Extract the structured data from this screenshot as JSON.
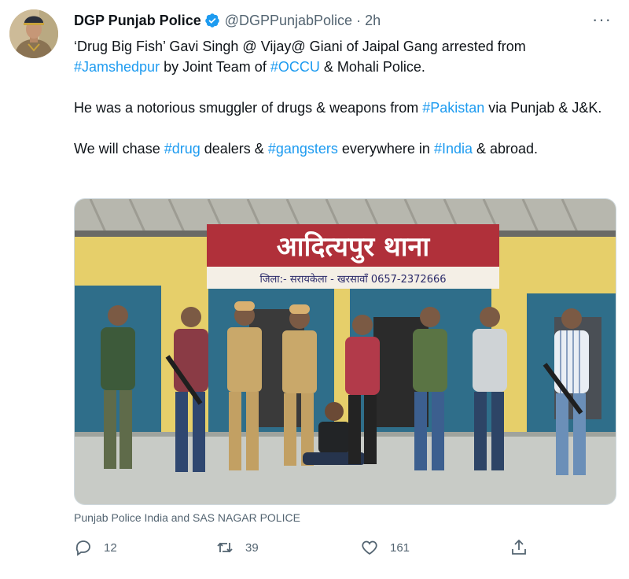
{
  "author": {
    "display_name": "DGP Punjab Police",
    "handle": "@DGPPunjabPolice",
    "separator": "·",
    "time": "2h"
  },
  "more_label": "···",
  "text": {
    "p1_a": "‘Drug Big Fish’ Gavi Singh @ Vijay@ Giani of Jaipal Gang arrested from ",
    "tag_jamshedpur": "#Jamshedpur",
    "p1_b": " by Joint Team of ",
    "tag_occu": "#OCCU",
    "p1_c": " & Mohali Police.",
    "p2_a": "He was a notorious smuggler of drugs & weapons from ",
    "tag_pakistan": "#Pakistan",
    "p2_b": " via Punjab & J&K.",
    "p3_a": "We will chase ",
    "tag_drug": "#drug",
    "p3_b": " dealers & ",
    "tag_gangsters": "#gangsters",
    "p3_c": " everywhere in ",
    "tag_india": "#India",
    "p3_d": " & abroad."
  },
  "media": {
    "sign_title": "आदित्यपुर थाना",
    "sign_subtitle": "जिला:- सरायकेला - खरसावाँ 0657-2372666"
  },
  "caption": "Punjab Police India and SAS NAGAR POLICE",
  "actions": {
    "reply_count": "12",
    "retweet_count": "39",
    "like_count": "161"
  },
  "colors": {
    "link": "#1d9bf0",
    "muted": "#536471",
    "sign_red": "#b0303a",
    "wall_yellow": "#e6cf6a",
    "door_blue": "#2f6e8a"
  }
}
